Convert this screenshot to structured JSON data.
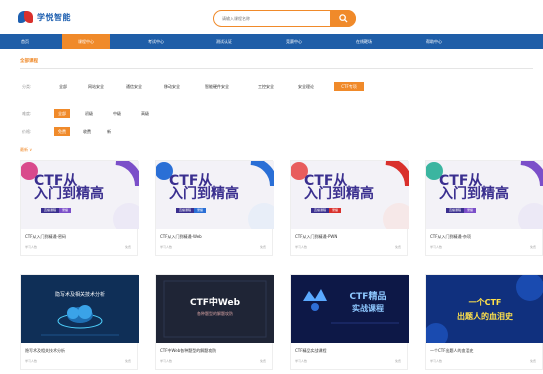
{
  "header": {
    "logo_text": "学悦智能",
    "search_placeholder": "请输入课程名称"
  },
  "nav": {
    "items": [
      {
        "label": "首页",
        "active": false
      },
      {
        "label": "课程中心",
        "active": true
      },
      {
        "label": "考试中心",
        "active": false
      },
      {
        "label": "测试认证",
        "active": false
      },
      {
        "label": "竞赛中心",
        "active": false
      },
      {
        "label": "在线靶场",
        "active": false
      },
      {
        "label": "帮助中心",
        "active": false
      }
    ]
  },
  "section": {
    "title": "全部课程"
  },
  "filters": {
    "category": {
      "label": "分类:",
      "options": [
        "全部",
        "网站安全",
        "通信安全",
        "移动安全",
        "智能硬件安全",
        "工控安全",
        "安全理论",
        "CTF专项"
      ],
      "selected": "CTF专项"
    },
    "level": {
      "label": "难度:",
      "options": [
        "全部",
        "初级",
        "中级",
        "高级"
      ],
      "selected": "全部"
    },
    "price": {
      "label": "价格:",
      "options": [
        "免费",
        "收费",
        "新"
      ],
      "selected": "免费"
    },
    "sort_label": "最新 ∨"
  },
  "courses": [
    {
      "title": "CTF从入门到精通-密码",
      "meta": "学习人数",
      "count": "免费",
      "thumb": {
        "l1": "CTF从",
        "l2": "入门到精高",
        "accent": "#7b4fc9",
        "tag1": "直播课程",
        "tag2": "录播"
      }
    },
    {
      "title": "CTF从入门到精通-Web",
      "meta": "学习人数",
      "count": "免费",
      "thumb": {
        "l1": "CTF从",
        "l2": "入门到精高",
        "accent": "#2a6fd6",
        "tag1": "直播课程",
        "tag2": "录播"
      }
    },
    {
      "title": "CTF从入门到精通-PWN",
      "meta": "学习人数",
      "count": "免费",
      "thumb": {
        "l1": "CTF从",
        "l2": "入门到精高",
        "accent": "#d9302c",
        "tag1": "直播课程",
        "tag2": "录播"
      }
    },
    {
      "title": "CTF从入门到精通-杂项",
      "meta": "学习人数",
      "count": "免费",
      "thumb": {
        "l1": "CTF从",
        "l2": "入门到精高",
        "accent": "#7b4fc9",
        "tag1": "直播课程",
        "tag2": "录播"
      }
    },
    {
      "title": "隐写术及相关技术分析",
      "meta": "学习人数",
      "count": "免费",
      "thumb": {
        "text": "隐写术及相关技术分析"
      }
    },
    {
      "title": "CTF中Web各种题型的解题攻防",
      "meta": "学习人数",
      "count": "免费",
      "thumb": {
        "l1": "CTF中Web",
        "l2": "各种题型的解题攻防"
      }
    },
    {
      "title": "CTF精品实战课程",
      "meta": "学习人数",
      "count": "免费",
      "thumb": {
        "l1": "CTF精品",
        "l2": "实战课程"
      }
    },
    {
      "title": "一个CTF出题人的血泪史",
      "meta": "学习人数",
      "count": "免费",
      "thumb": {
        "l1": "一个CTF",
        "l2": "出题人的血泪史"
      }
    }
  ]
}
